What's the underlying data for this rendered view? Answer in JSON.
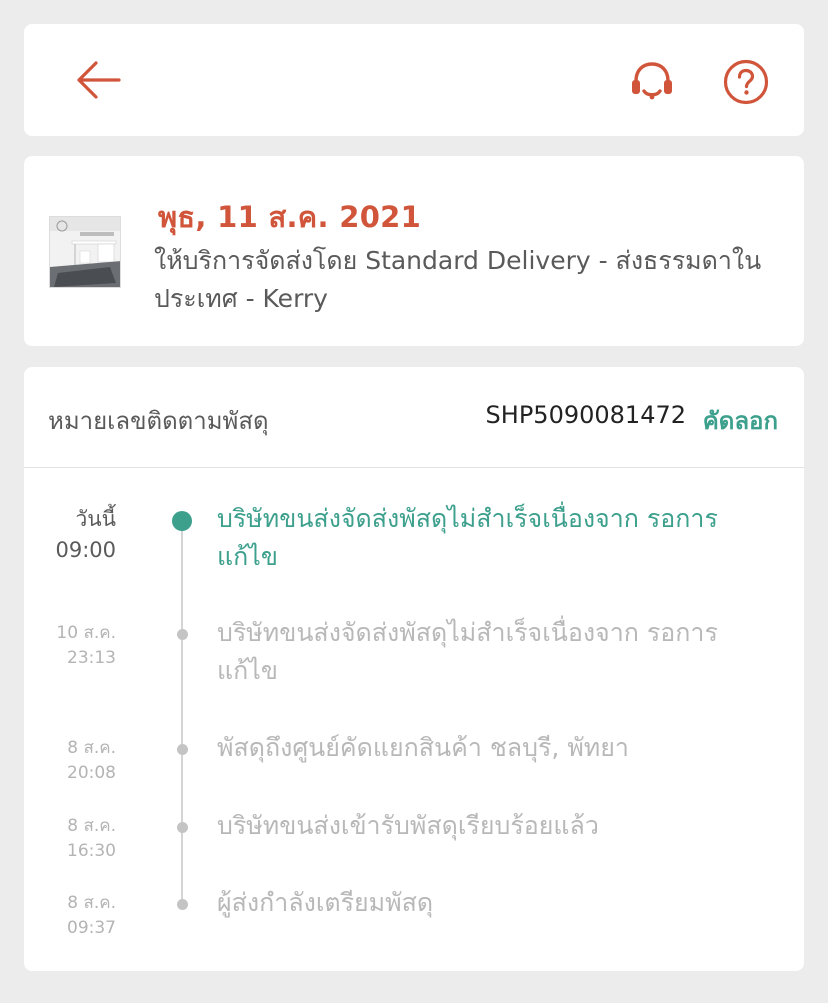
{
  "header": {
    "back_icon": "arrow-left-icon",
    "support_icon": "headset-icon",
    "help_icon": "question-circle-icon",
    "accent_color": "#d0553a"
  },
  "delivery": {
    "thumbnail_icon": "product-thumbnail",
    "date": "พุธ, 11 ส.ค. 2021",
    "description": "ให้บริการจัดส่งโดย Standard Delivery - ส่งธรรมดาในประเทศ - Kerry"
  },
  "tracking": {
    "label": "หมายเลขติดตามพัสดุ",
    "number": "SHP5090081472",
    "copy_label": "คัดลอก",
    "active_color": "#3da08d",
    "events": [
      {
        "date": "วันนี้",
        "time": "09:00",
        "description": "บริษัทขนส่งจัดส่งพัสดุไม่สำเร็จเนื่องจาก รอการแก้ไข"
      },
      {
        "date": "10 ส.ค.",
        "time": "23:13",
        "description": "บริษัทขนส่งจัดส่งพัสดุไม่สำเร็จเนื่องจาก รอการแก้ไข"
      },
      {
        "date": "8 ส.ค.",
        "time": "20:08",
        "description": "พัสดุถึงศูนย์คัดแยกสินค้า ชลบุรี, พัทยา"
      },
      {
        "date": "8 ส.ค.",
        "time": "16:30",
        "description": "บริษัทขนส่งเข้ารับพัสดุเรียบร้อยแล้ว"
      },
      {
        "date": "8 ส.ค.",
        "time": "09:37",
        "description": "ผู้ส่งกำลังเตรียมพัสดุ"
      }
    ]
  }
}
